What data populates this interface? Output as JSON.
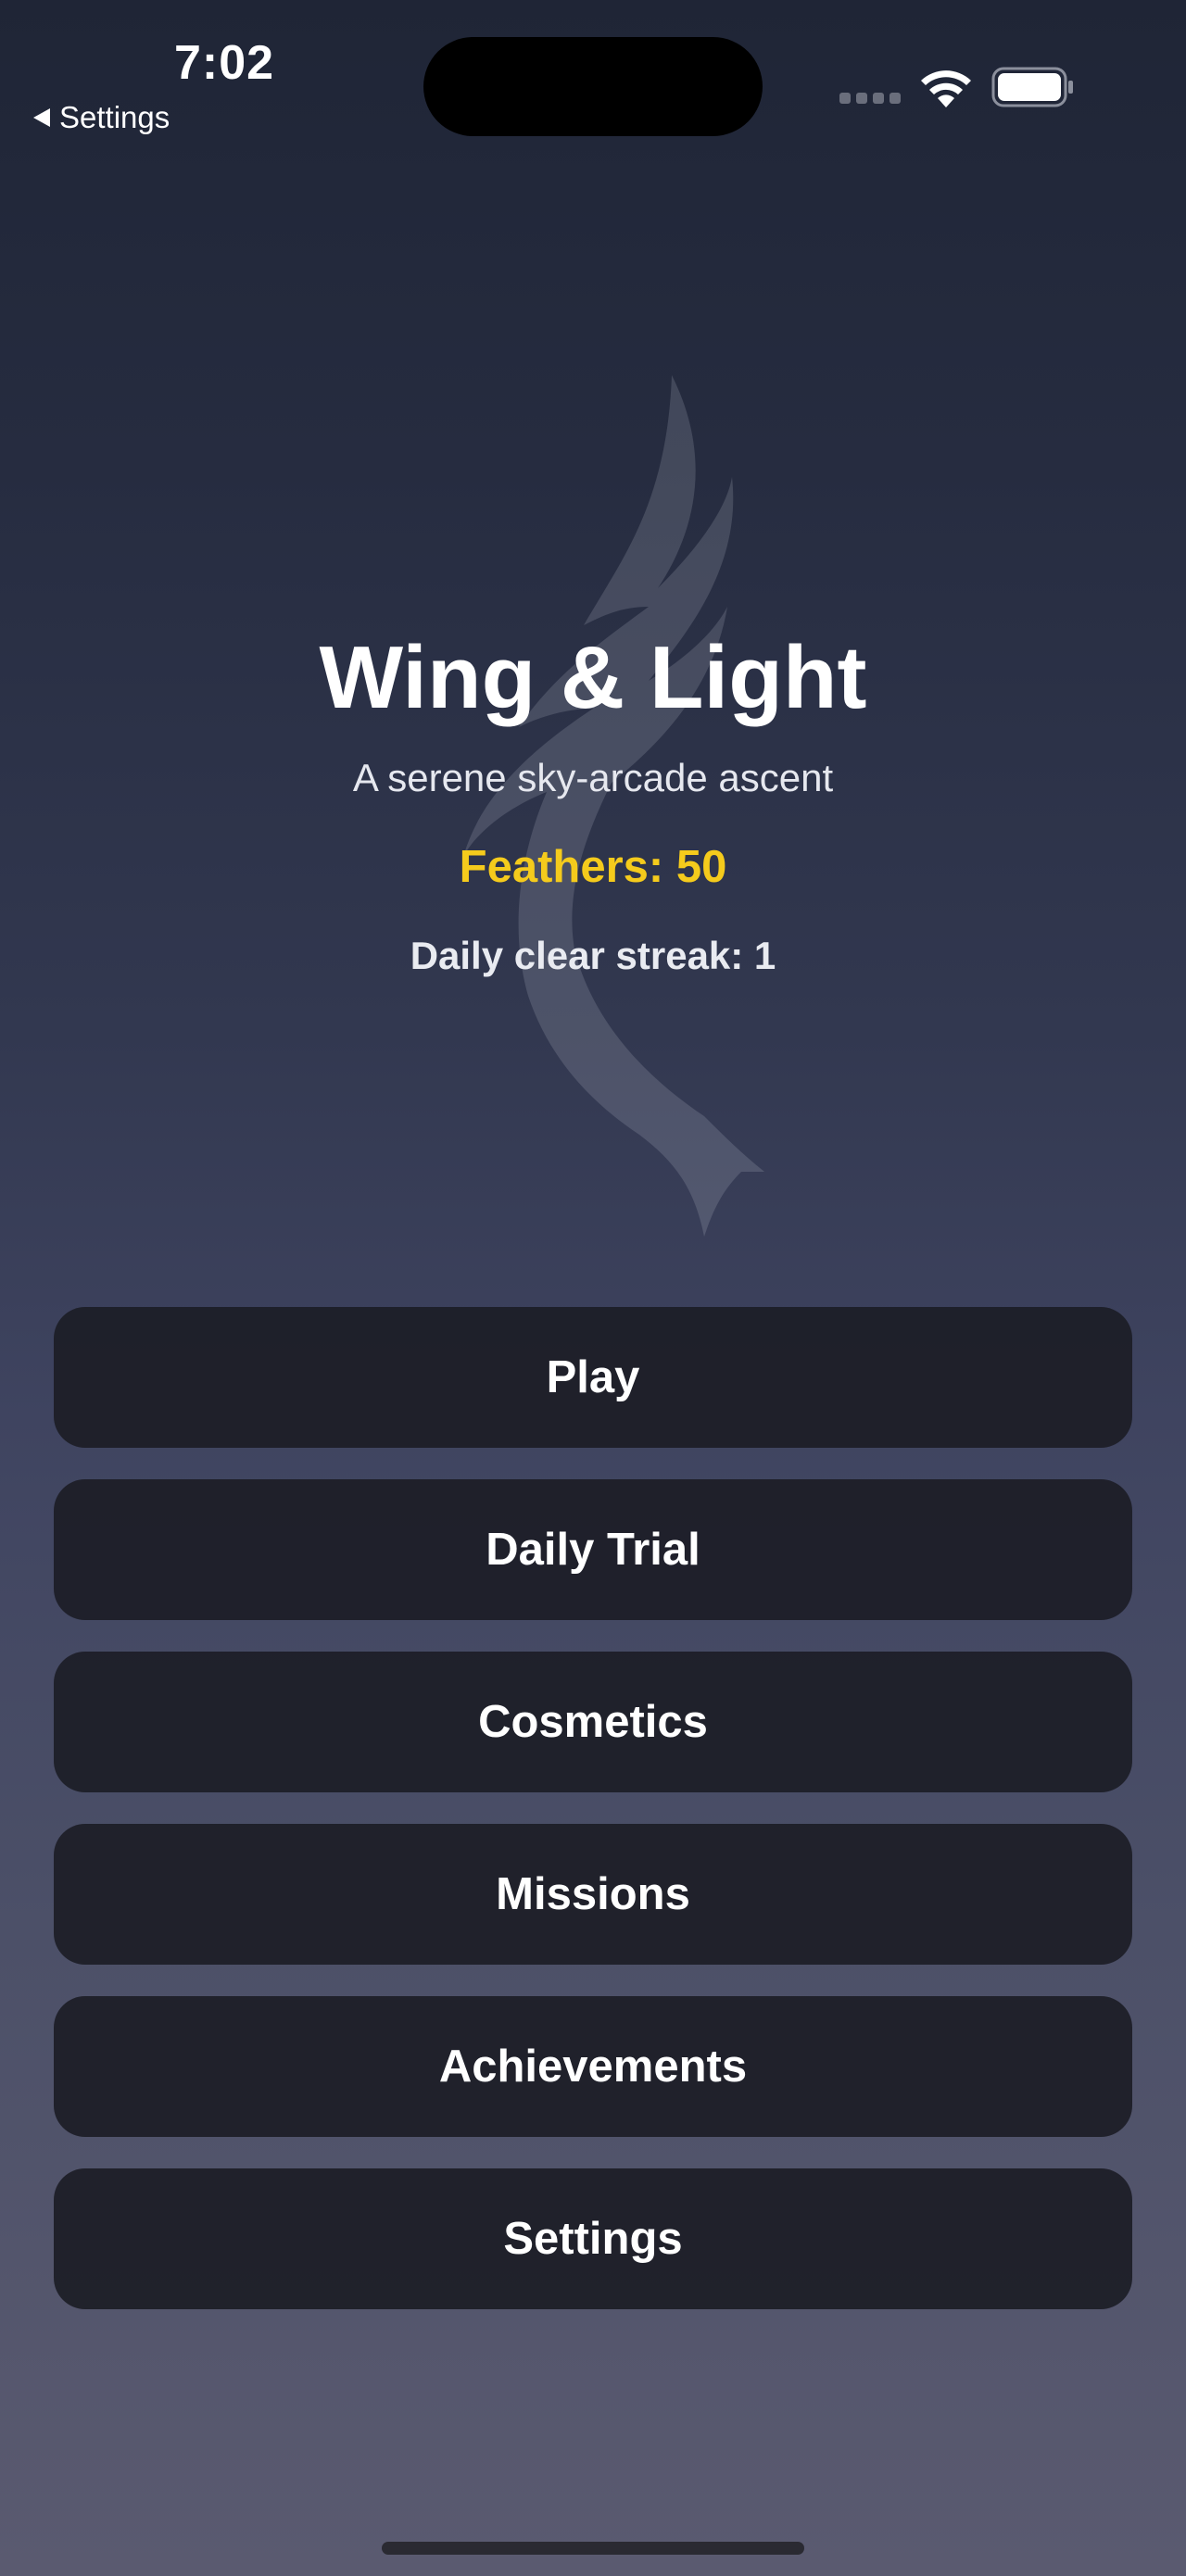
{
  "status_bar": {
    "time": "7:02",
    "back_label": "Settings"
  },
  "hero": {
    "title": "Wing & Light",
    "subtitle": "A serene sky-arcade ascent",
    "feathers": "Feathers: 50",
    "streak": "Daily clear streak: 1",
    "emblem_icon": "wing-icon"
  },
  "menu": {
    "items": [
      {
        "label": "Play"
      },
      {
        "label": "Daily Trial"
      },
      {
        "label": "Cosmetics"
      },
      {
        "label": "Missions"
      },
      {
        "label": "Achievements"
      },
      {
        "label": "Settings"
      }
    ]
  },
  "colors": {
    "background_top": "#1f2536",
    "background_bottom": "#5a5a70",
    "accent_feathers": "#f5cb1c",
    "button_bg": "#1c1d26"
  }
}
